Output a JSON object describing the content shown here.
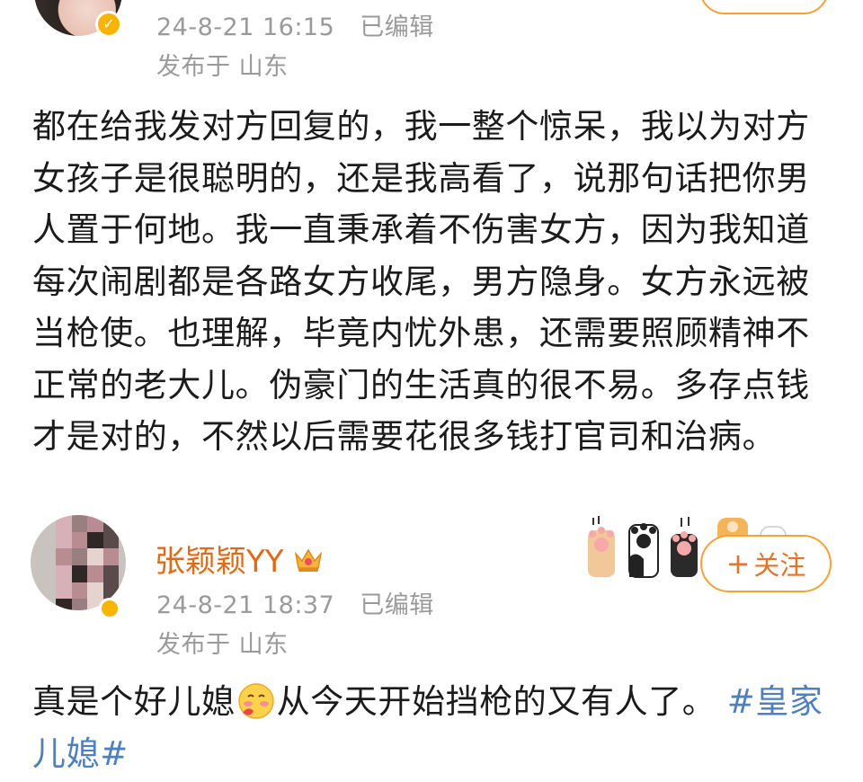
{
  "post_top": {
    "timestamp": "24-8-21 16:15",
    "edited": "已编辑",
    "location": "发布于 山东",
    "body": "都在给我发对方回复的，我一整个惊呆，我以为对方女孩子是很聪明的，还是我高看了，说那句话把你男人置于何地。我一直秉承着不伤害女方，因为我知道每次闹剧都是各路女方收尾，男方隐身。女方永远被当枪使。也理解，毕竟内忧外患，还需要照顾精神不正常的老大儿。伪豪门的生活真的很不易。多存点钱才是对的，不然以后需要花很多钱打官司和治病。"
  },
  "post_second": {
    "username": "张颖颖YY",
    "timestamp": "24-8-21 18:37",
    "edited": "已编辑",
    "location": "发布于 山东",
    "follow_label": "关注",
    "body_text_1": "真是个好儿媳",
    "body_text_2": "从今天开始挡枪的又有人了。",
    "hashtag": "#皇家儿媳#"
  },
  "colors": {
    "username": "#e06b17",
    "meta": "#9a9a9a",
    "hashtag": "#4f7fbd",
    "follow_border": "#f3a23a",
    "verified": "#f7b500"
  }
}
